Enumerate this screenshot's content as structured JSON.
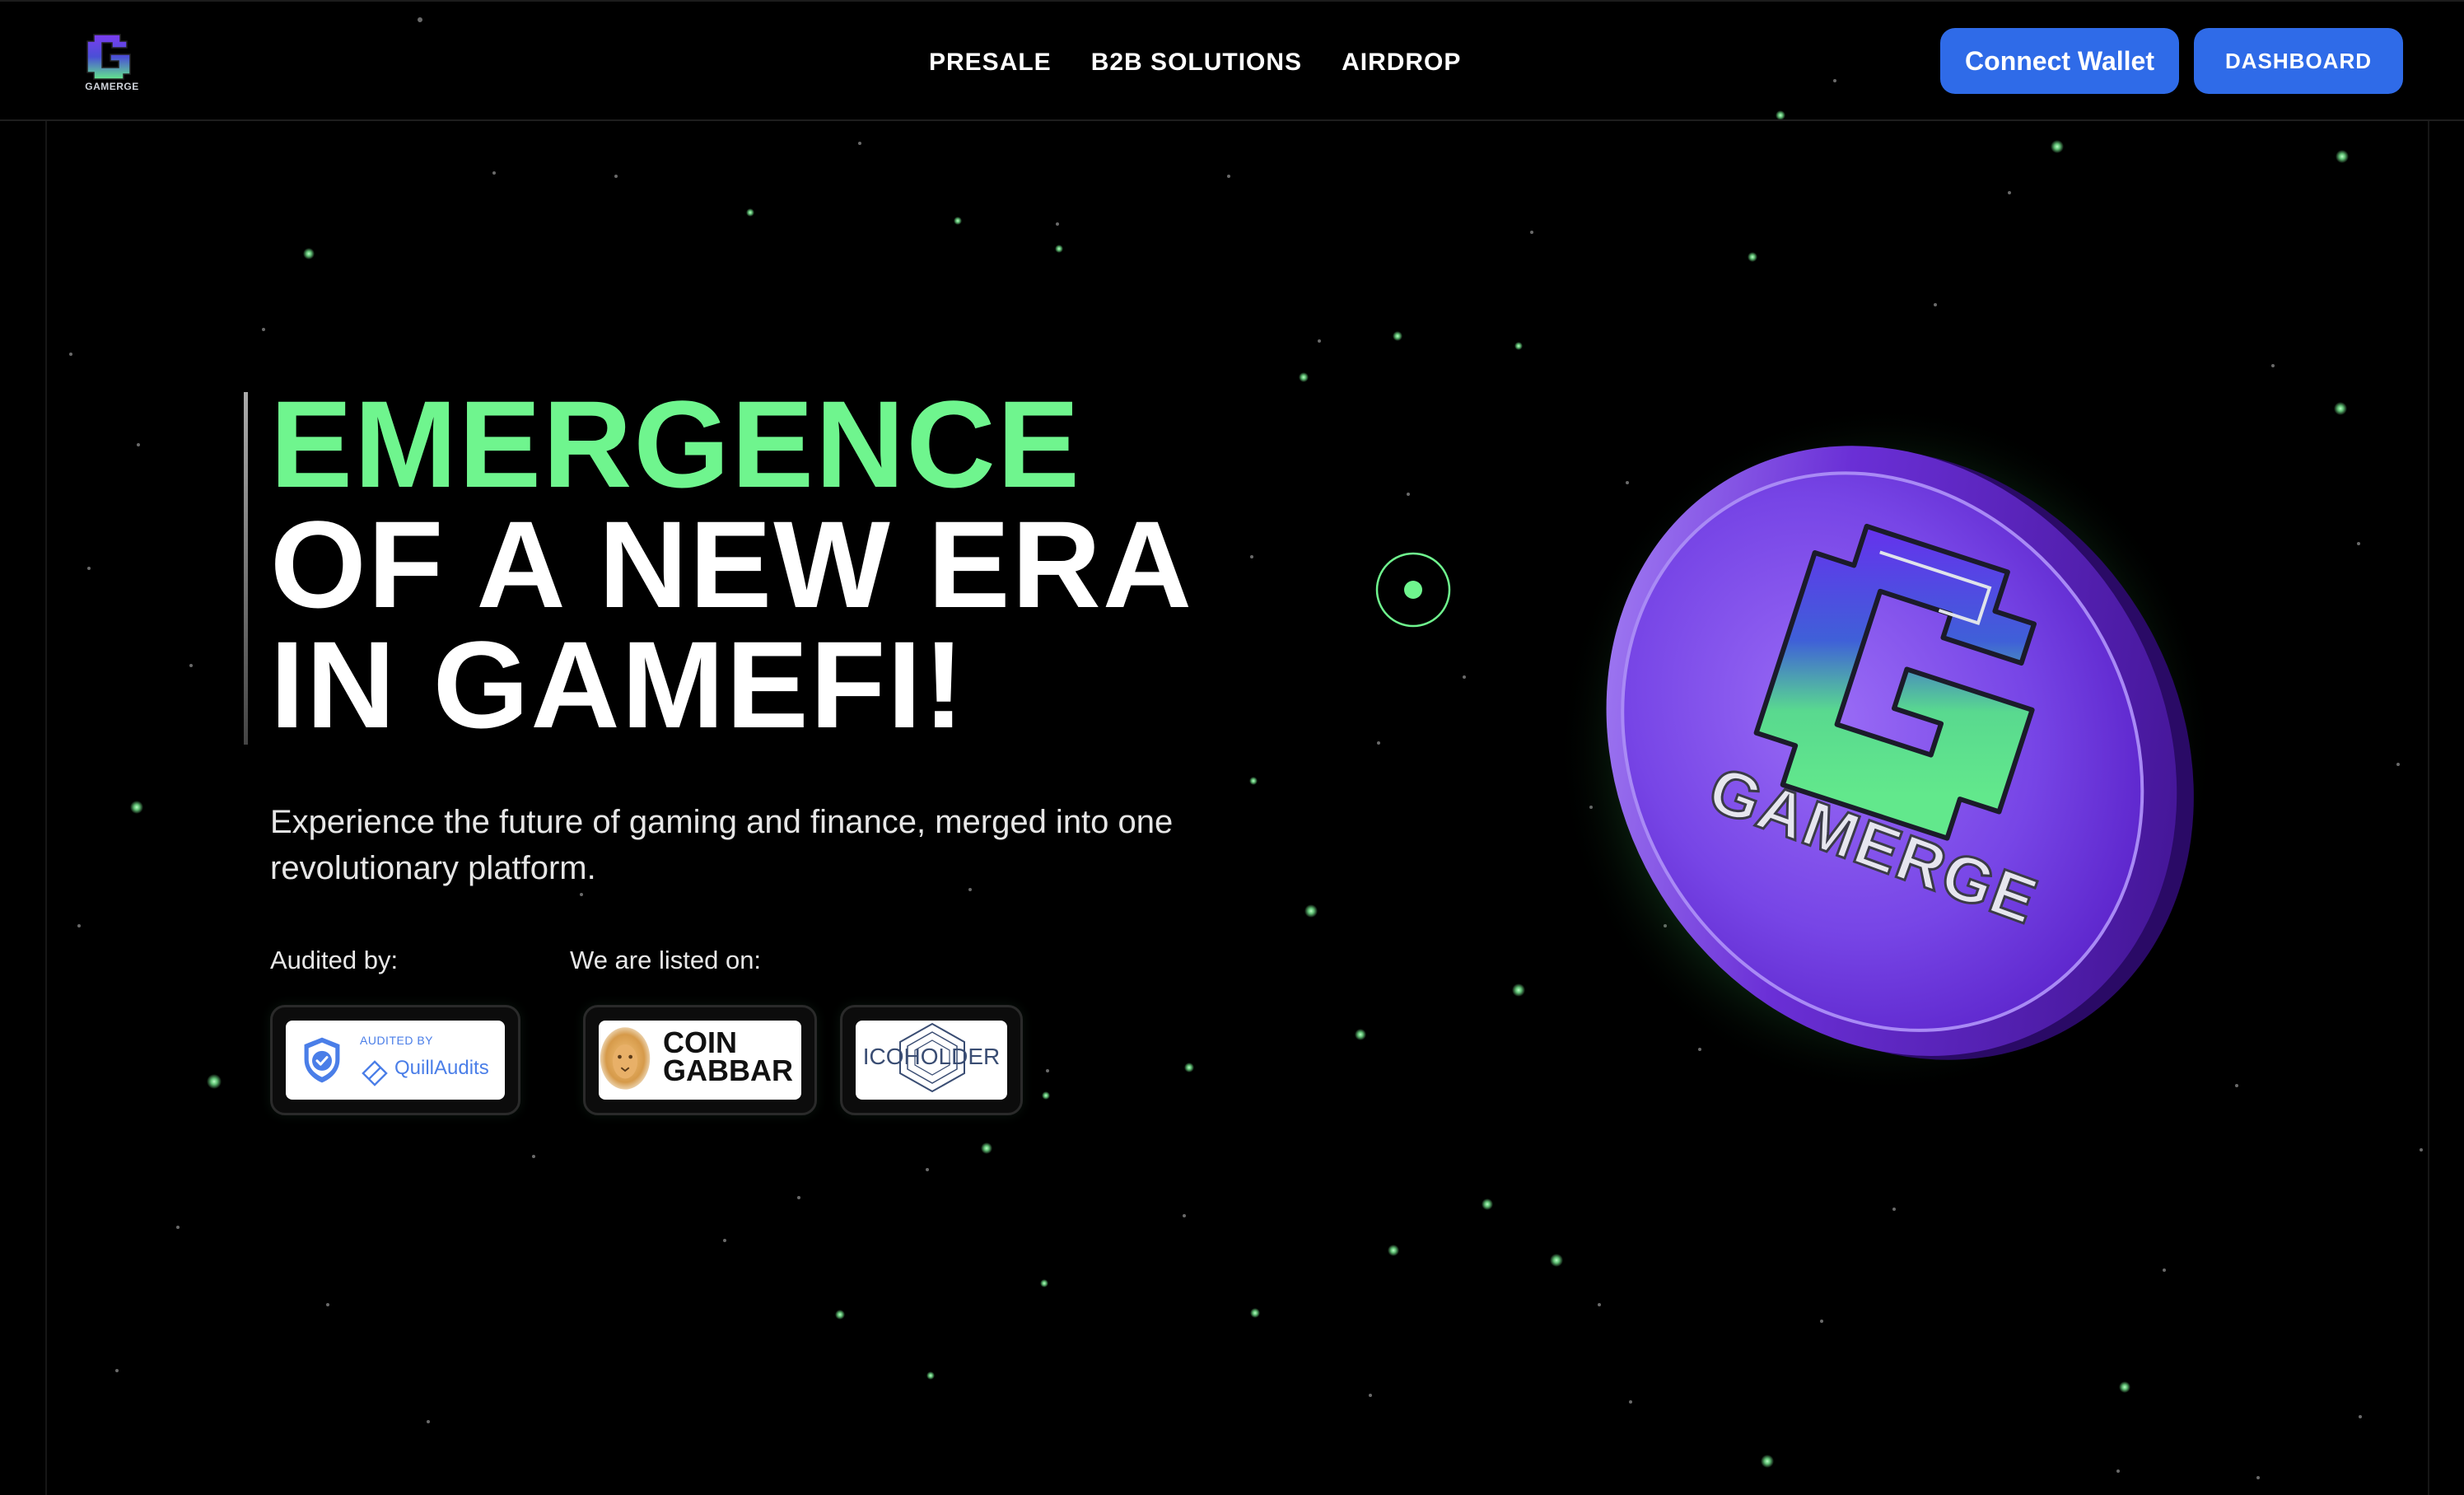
{
  "brand": {
    "logo_text": "GAMERGE",
    "green": "#6ff58e",
    "blue": "#2f6be8",
    "purple": "#7b4fe0"
  },
  "nav": {
    "items": [
      "PRESALE",
      "B2B SOLUTIONS",
      "AIRDROP"
    ]
  },
  "header": {
    "connect_label": "Connect Wallet",
    "dashboard_label": "DASHBOARD"
  },
  "hero": {
    "line1": "EMERGENCE",
    "line2": "OF A NEW ERA",
    "line3": "IN GAMEFI!",
    "subtitle": "Experience the future of gaming and finance, merged into one revolutionary platform.",
    "audited_label": "Audited by:",
    "listed_label": "We are listed on:"
  },
  "badges": {
    "quill_small": "AUDITED BY",
    "quill_name": "QuillAudits",
    "coin_line1": "COIN",
    "coin_line2": "GABBAR",
    "ico_name": "ICOHOLDER"
  },
  "coin": {
    "text": "GAMERGE"
  },
  "icons": [
    "gamerge-logo-icon",
    "target-ring-icon",
    "shield-check-icon",
    "quill-logo-icon",
    "lion-icon",
    "hexagon-icon",
    "gamerge-coin-icon"
  ]
}
